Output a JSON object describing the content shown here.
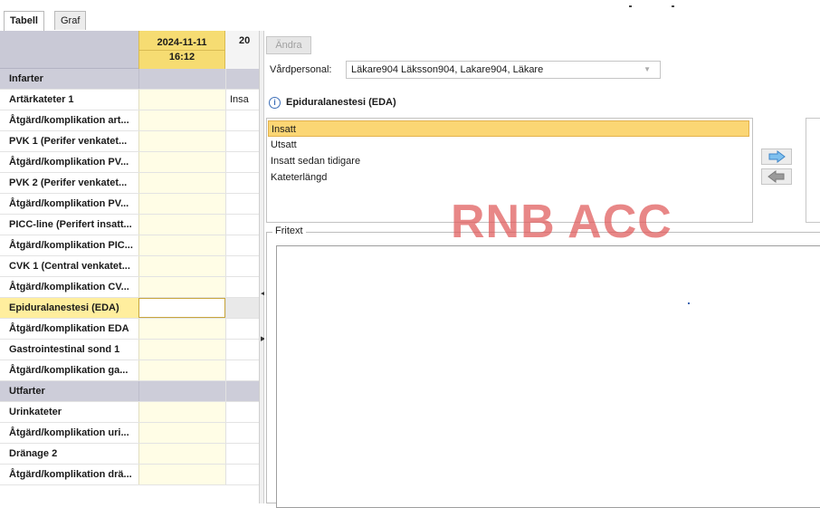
{
  "tabs": [
    {
      "label": "Tabell",
      "active": true
    },
    {
      "label": "Graf",
      "active": false
    }
  ],
  "table": {
    "columns": [
      {
        "date": "2024-11-11",
        "time": "16:12"
      },
      {
        "date": "20",
        "time": ""
      }
    ],
    "rows": [
      {
        "label": "Infarter",
        "section": true,
        "value": ""
      },
      {
        "label": "Artärkateter 1",
        "value": "Insa"
      },
      {
        "label": "Åtgärd/komplikation art...",
        "value": ""
      },
      {
        "label": "PVK 1 (Perifer venkatet...",
        "value": ""
      },
      {
        "label": "Åtgärd/komplikation PV...",
        "value": ""
      },
      {
        "label": "PVK 2 (Perifer venkatet...",
        "value": ""
      },
      {
        "label": "Åtgärd/komplikation PV...",
        "value": ""
      },
      {
        "label": "PICC-line (Perifert insatt...",
        "value": ""
      },
      {
        "label": "Åtgärd/komplikation PIC...",
        "value": ""
      },
      {
        "label": "CVK 1 (Central venkatet...",
        "value": ""
      },
      {
        "label": "Åtgärd/komplikation CV...",
        "value": ""
      },
      {
        "label": "Epiduralanestesi (EDA)",
        "selected": true,
        "value": ""
      },
      {
        "label": "Åtgärd/komplikation EDA",
        "value": ""
      },
      {
        "label": "Gastrointestinal sond 1",
        "value": ""
      },
      {
        "label": "Åtgärd/komplikation ga...",
        "value": ""
      },
      {
        "label": "Utfarter",
        "section": true,
        "value": ""
      },
      {
        "label": "Urinkateter",
        "value": ""
      },
      {
        "label": "Åtgärd/komplikation uri...",
        "value": ""
      },
      {
        "label": "Dränage 2",
        "value": ""
      },
      {
        "label": "Åtgärd/komplikation drä...",
        "value": ""
      }
    ]
  },
  "right": {
    "andra_label": "Ändra",
    "vardpersonal_label": "Vårdpersonal:",
    "vardpersonal_value": "Läkare904 Läksson904, Lakare904, Läkare",
    "eda_title": "Epiduralanestesi (EDA)",
    "options": [
      {
        "label": "Insatt",
        "selected": true
      },
      {
        "label": "Utsatt",
        "selected": false
      },
      {
        "label": "Insatt sedan tidigare",
        "selected": false
      },
      {
        "label": "Kateterlängd",
        "selected": false
      }
    ],
    "fritext_label": "Fritext",
    "fritext_value": "",
    "watermark": "RNB ACC"
  },
  "colors": {
    "accent_yellow": "#f6dc72",
    "section_header": "#cdcdd9",
    "selection": "#fbd674",
    "watermark": "#e05a5a",
    "arrow_blue": "#5aa6e6"
  }
}
